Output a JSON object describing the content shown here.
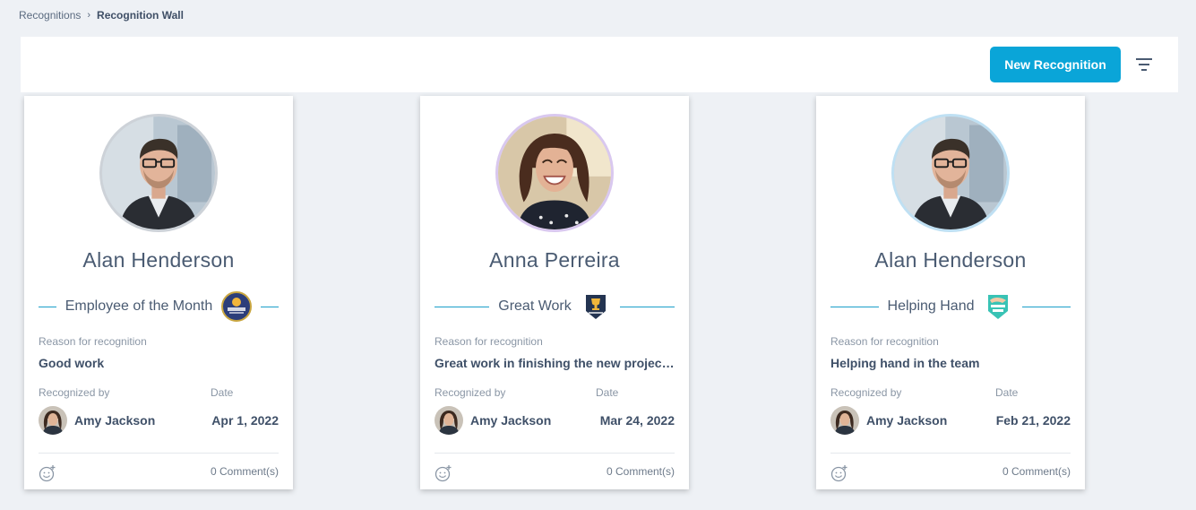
{
  "breadcrumb": {
    "parent": "Recognitions",
    "separator": "›",
    "current": "Recognition Wall"
  },
  "toolbar": {
    "new_button_label": "New Recognition",
    "filter_icon": "filter-icon"
  },
  "colors": {
    "accent": "#0aa5d8",
    "divider_line": "#1a9fc9",
    "background": "#eef1f5"
  },
  "labels": {
    "reason": "Reason for recognition",
    "recognized_by": "Recognized by",
    "date": "Date"
  },
  "cards": [
    {
      "name": "Alan Henderson",
      "badge": "Employee of the Month",
      "badge_icon": "employee-of-month-badge-icon",
      "reason": "Good work",
      "recognized_by": "Amy Jackson",
      "date": "Apr 1, 2022",
      "comments": "0 Comment(s)"
    },
    {
      "name": "Anna Perreira",
      "badge": "Great Work",
      "badge_icon": "great-work-badge-icon",
      "reason": "Great work in finishing the new project! ...",
      "recognized_by": "Amy Jackson",
      "date": "Mar 24, 2022",
      "comments": "0 Comment(s)"
    },
    {
      "name": "Alan Henderson",
      "badge": "Helping Hand",
      "badge_icon": "helping-hand-badge-icon",
      "reason": "Helping hand in the team",
      "recognized_by": "Amy Jackson",
      "date": "Feb 21, 2022",
      "comments": "0 Comment(s)"
    }
  ]
}
